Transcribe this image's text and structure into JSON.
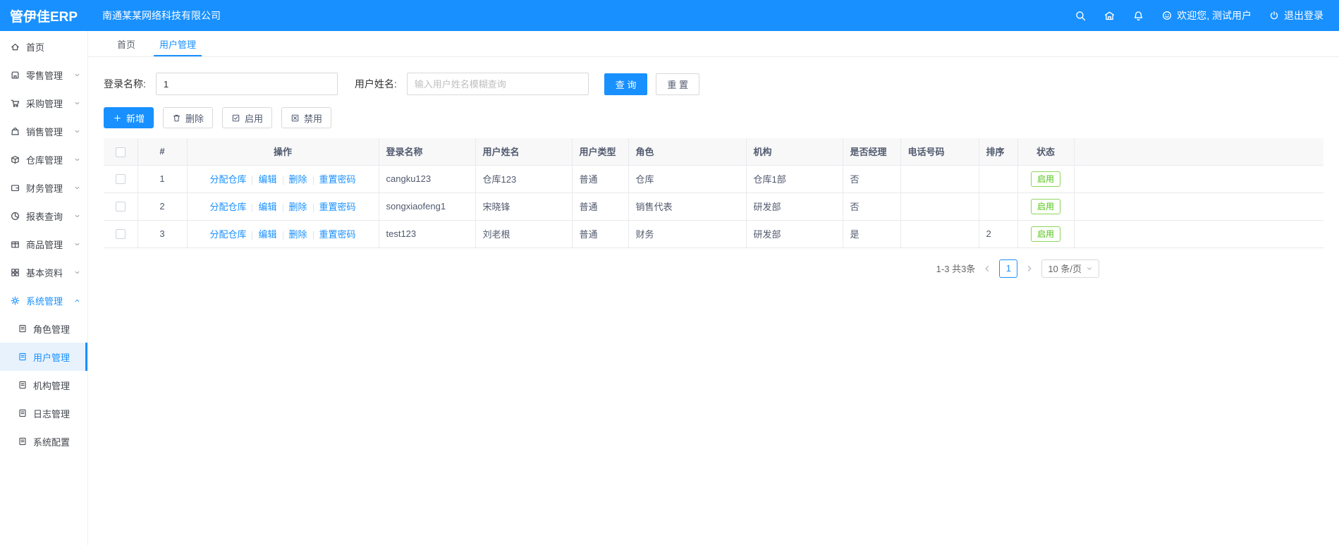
{
  "topbar": {
    "logo": "管伊佳ERP",
    "company": "南通某某网络科技有限公司",
    "welcome": "欢迎您, 测试用户",
    "logout": "退出登录"
  },
  "sidebar": {
    "items": [
      {
        "label": "首页"
      },
      {
        "label": "零售管理"
      },
      {
        "label": "采购管理"
      },
      {
        "label": "销售管理"
      },
      {
        "label": "仓库管理"
      },
      {
        "label": "财务管理"
      },
      {
        "label": "报表查询"
      },
      {
        "label": "商品管理"
      },
      {
        "label": "基本资料"
      },
      {
        "label": "系统管理"
      }
    ],
    "system_children": [
      {
        "label": "角色管理"
      },
      {
        "label": "用户管理"
      },
      {
        "label": "机构管理"
      },
      {
        "label": "日志管理"
      },
      {
        "label": "系统配置"
      }
    ]
  },
  "tabs": {
    "home": "首页",
    "current": "用户管理"
  },
  "filters": {
    "login_label": "登录名称:",
    "login_value": "1",
    "name_label": "用户姓名:",
    "name_placeholder": "输入用户姓名模糊查询",
    "search_button": "查 询",
    "reset_button": "重 置"
  },
  "toolbar": {
    "add": "新增",
    "delete": "删除",
    "enable": "启用",
    "disable": "禁用"
  },
  "table": {
    "headers": {
      "index": "#",
      "actions": "操作",
      "login": "登录名称",
      "name": "用户姓名",
      "type": "用户类型",
      "role": "角色",
      "org": "机构",
      "manager": "是否经理",
      "phone": "电话号码",
      "sort": "排序",
      "status": "状态"
    },
    "action_links": {
      "assign": "分配仓库",
      "edit": "编辑",
      "delete": "删除",
      "reset_pwd": "重置密码"
    },
    "rows": [
      {
        "index": "1",
        "login": "cangku123",
        "name": "仓库123",
        "type": "普通",
        "role": "仓库",
        "org": "仓库1部",
        "manager": "否",
        "phone": "",
        "sort": "",
        "status": "启用"
      },
      {
        "index": "2",
        "login": "songxiaofeng1",
        "name": "宋晓锋",
        "type": "普通",
        "role": "销售代表",
        "org": "研发部",
        "manager": "否",
        "phone": "",
        "sort": "",
        "status": "启用"
      },
      {
        "index": "3",
        "login": "test123",
        "name": "刘老根",
        "type": "普通",
        "role": "财务",
        "org": "研发部",
        "manager": "是",
        "phone": "",
        "sort": "2",
        "status": "启用"
      }
    ]
  },
  "pagination": {
    "total_text": "1-3 共3条",
    "current_page": "1",
    "page_size": "10 条/页"
  },
  "colors": {
    "primary": "#1890ff",
    "success": "#52c41a"
  }
}
